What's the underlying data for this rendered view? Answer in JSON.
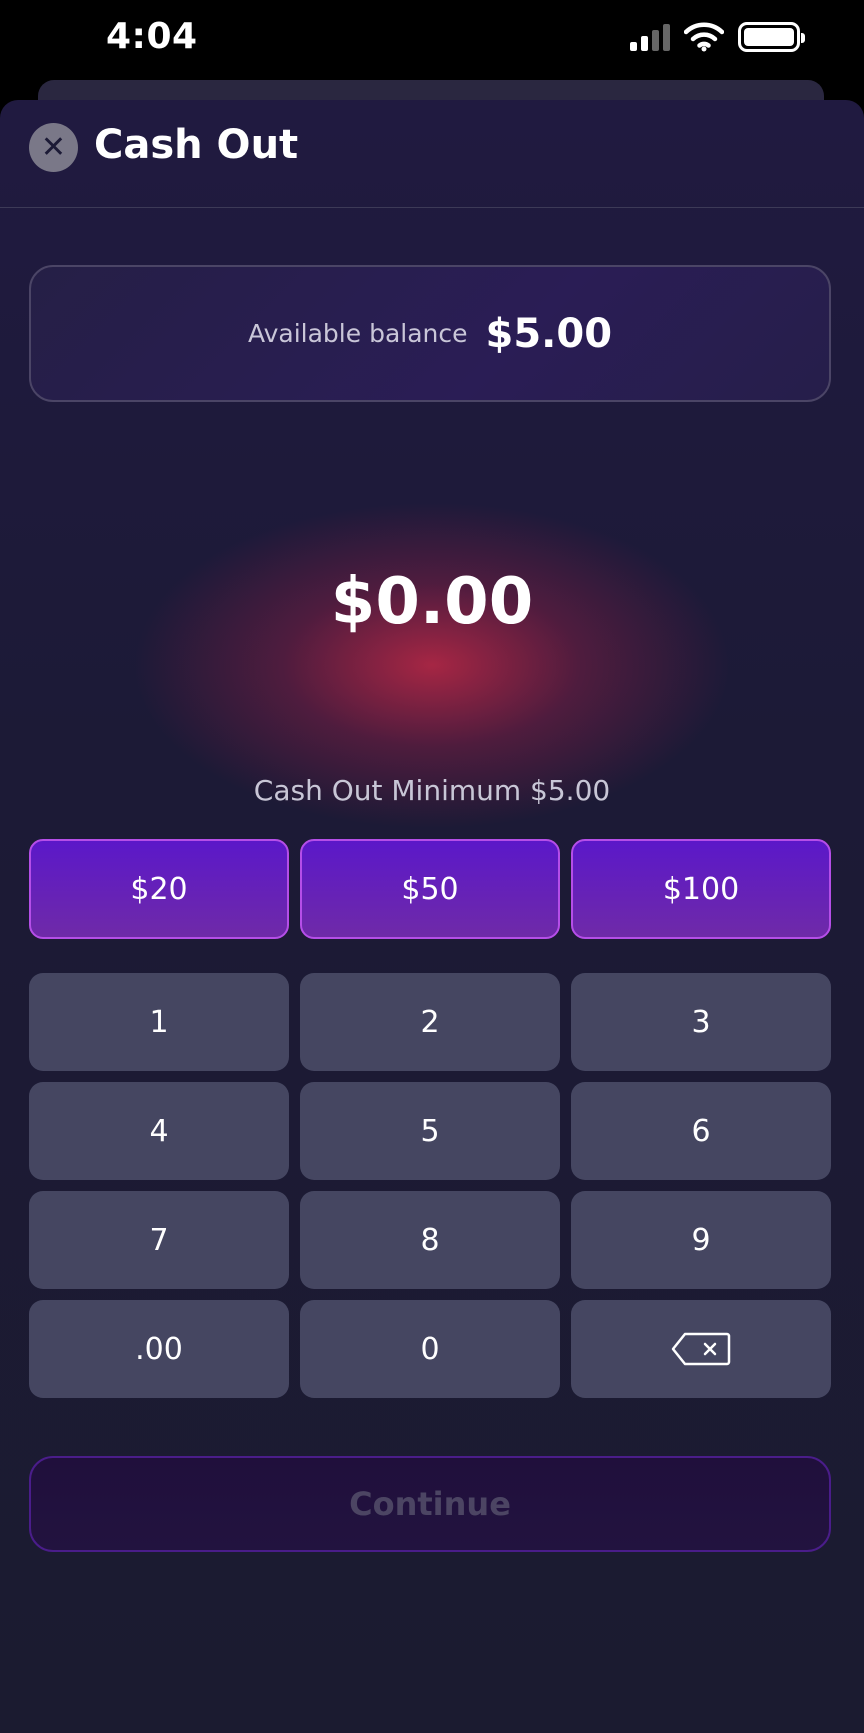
{
  "status_bar": {
    "time": "4:04",
    "icons": [
      "cellular-signal-icon",
      "wifi-icon",
      "battery-icon"
    ]
  },
  "header": {
    "title": "Cash Out",
    "close_icon": "close-icon"
  },
  "balance": {
    "label": "Available balance",
    "value": "$5.00"
  },
  "amount": {
    "display": "$0.00"
  },
  "minimum_text": "Cash Out Minimum $5.00",
  "quick_amounts": [
    "$20",
    "$50",
    "$100"
  ],
  "keypad": {
    "keys": [
      "1",
      "2",
      "3",
      "4",
      "5",
      "6",
      "7",
      "8",
      "9",
      ".00",
      "0"
    ],
    "backspace_icon": "backspace-icon"
  },
  "continue_label": "Continue",
  "colors": {
    "accent_purple": "#5b18c9",
    "accent_border": "#b54ee8",
    "key_background": "#454661",
    "glow_red": "#be2846"
  }
}
